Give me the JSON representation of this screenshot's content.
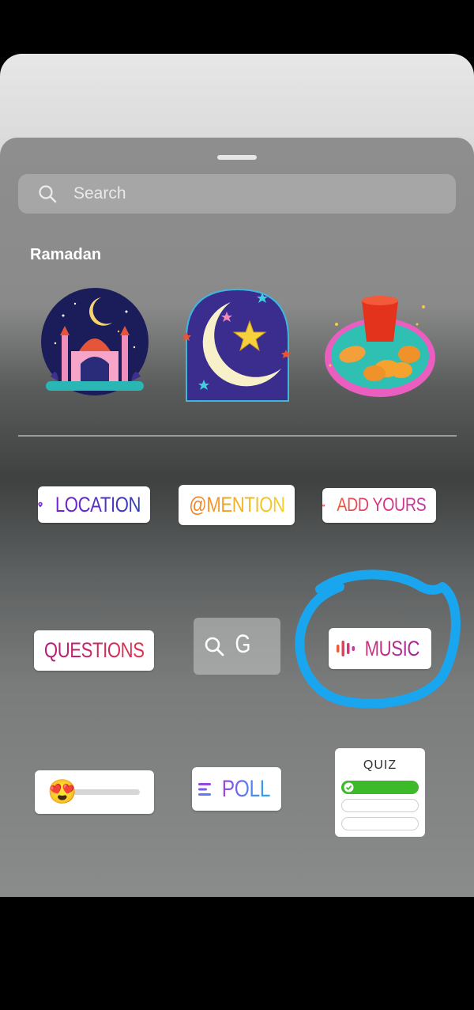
{
  "search": {
    "placeholder": "Search"
  },
  "section": {
    "title": "Ramadan"
  },
  "stickers": {
    "mosque": "mosque-sticker",
    "moon": "crescent-moon-sticker",
    "dates": "dates-and-tea-sticker"
  },
  "chips": {
    "location": "LOCATION",
    "mention": "@MENTION",
    "add_yours": "ADD YOURS",
    "questions": "QUESTIONS",
    "gif_search": "G",
    "music": "MUSIC",
    "poll": "POLL",
    "quiz": "QUIZ"
  },
  "emoji_slider": {
    "emoji": "😍",
    "value": 0
  },
  "colors": {
    "annotation_circle": "#1aa6ef",
    "quiz_correct": "#3cba2a"
  }
}
